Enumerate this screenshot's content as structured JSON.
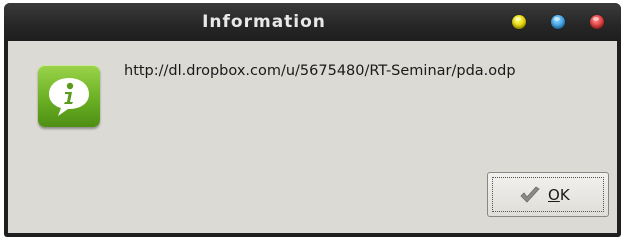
{
  "window": {
    "title": "Information"
  },
  "titlebar_buttons": {
    "minimize_color": "#e6d400",
    "maximize_color": "#3aa0e6",
    "close_color": "#e03a3a"
  },
  "dialog": {
    "icon": "info-icon",
    "icon_color": "#6bb024",
    "message": "http://dl.dropbox.com/u/5675480/RT-Seminar/pda.odp"
  },
  "ok_button": {
    "icon": "checkmark-icon",
    "mnemonic": "O",
    "label_rest": "K"
  }
}
